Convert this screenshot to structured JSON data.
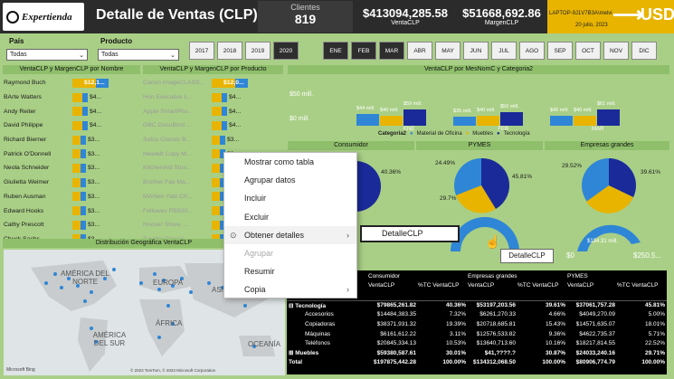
{
  "header": {
    "logo_text": "Expertienda",
    "title": "Detalle de Ventas (CLP)",
    "clients_label": "Clientes",
    "clients_value": "819",
    "venta_value": "$413094,285.58",
    "venta_label": "VentaCLP",
    "margen_value": "$51668,692.86",
    "margen_label": "MargenCLP",
    "user": "LAPTOP-9J1V7B3A\\melvi",
    "date": "20 julio, 2023",
    "currency": "USD"
  },
  "filters": {
    "pais_label": "País",
    "pais_value": "Todas",
    "producto_label": "Producto",
    "producto_value": "Todas"
  },
  "years": [
    "2017",
    "2018",
    "2019",
    "2020"
  ],
  "months": [
    "ENE",
    "FEB",
    "MAR",
    "ABR",
    "MAY",
    "JUN",
    "JUL",
    "AGO",
    "SEP",
    "OCT",
    "NOV",
    "DIC"
  ],
  "colors": {
    "gold": "#e8b400",
    "blue": "#2f86d6",
    "navy": "#1a2a99",
    "bg": "#a9cf86"
  },
  "sections": {
    "por_nombre": "VentaCLP y MargenCLP por Nombre",
    "por_producto": "VentaCLP y MargenCLP por Producto",
    "por_mes": "VentaCLP por MesNomC y Categoria2",
    "mapa": "Distribución Geográfica VentaCLP"
  },
  "nombres": [
    {
      "name": "Raymond Buch",
      "val": "$12,1..."
    },
    {
      "name": "BArte Watters",
      "val": "$4..."
    },
    {
      "name": "Andy Reiter",
      "val": "$4..."
    },
    {
      "name": "David Philippe",
      "val": "$4..."
    },
    {
      "name": "Richard Bierner",
      "val": "$3..."
    },
    {
      "name": "Patrick O'Donnell",
      "val": "$3..."
    },
    {
      "name": "Neola Schneider",
      "val": "$3..."
    },
    {
      "name": "Giulietta Weimer",
      "val": "$3..."
    },
    {
      "name": "Ruben Ausman",
      "val": "$3..."
    },
    {
      "name": "Edward Hooks",
      "val": "$3..."
    },
    {
      "name": "Cathy Prescott",
      "val": "$3..."
    },
    {
      "name": "Chuck Sachs",
      "val": "$3..."
    }
  ],
  "productos": [
    {
      "name": "Canon imageCLASS...",
      "val": "$12,0..."
    },
    {
      "name": "Hon Executive L...",
      "val": "$4..."
    },
    {
      "name": "Apple SmartPho...",
      "val": "$4..."
    },
    {
      "name": "GBC DocuBind ...",
      "val": "$4..."
    },
    {
      "name": "Safco Classic B...",
      "val": "$3..."
    },
    {
      "name": "Hewlett Copy M...",
      "val": "$3..."
    },
    {
      "name": "KitchenAid Stov...",
      "val": "$3..."
    },
    {
      "name": "Brother Fax Ma...",
      "val": "$3..."
    },
    {
      "name": "MArtein Yale Ch...",
      "val": "$3..."
    },
    {
      "name": "Fellowes PB500...",
      "val": "$3..."
    },
    {
      "name": "Hoover Stove, ...",
      "val": "$3..."
    },
    {
      "name": "Sauder Classic...",
      "val": "$3..."
    }
  ],
  "chart_mes": {
    "y_labels": [
      "$50 mill.",
      "$0 mill."
    ],
    "months": [
      "ENE",
      "FEB",
      "MAR"
    ],
    "labels": [
      [
        "$44 mill.",
        "$40 mill.",
        "$59 mill."
      ],
      [
        "$35 mill.",
        "$40 mill.",
        "$50 mill."
      ],
      [
        "$40 mill.",
        "$40 mill.",
        "$61 mill."
      ]
    ],
    "legend_title": "Categoria2",
    "legend": [
      "Material de Oficina",
      "Muebles",
      "Tecnología"
    ]
  },
  "segmentos": {
    "consumidor": "Consumidor",
    "pymes": "PYMES",
    "grandes": "Empresas grandes",
    "consumidor_pcts": [
      "40.36%"
    ],
    "pymes_pcts": [
      "24.49%",
      "29.7%",
      "45.81%"
    ],
    "grandes_pcts": [
      "29.52%",
      "39.61%"
    ],
    "gauge_min": "$0",
    "gauge_center": "$134.31 mill.",
    "gauge_max": "$250.5..."
  },
  "map": {
    "labels": [
      "AMÉRICA DEL NORTE",
      "EUROPA",
      "ASIA",
      "ÁFRICA",
      "AMÉRICA DEL SUR",
      "OCEANÍA"
    ],
    "bing": "Microsoft Bing",
    "copy": "© 2023 TomTom, © 2023 Microsoft Corporation"
  },
  "menu": {
    "items": [
      "Mostrar como tabla",
      "Agrupar datos",
      "Incluir",
      "Excluir",
      "Obtener detalles",
      "Agrupar",
      "Resumir",
      "Copia"
    ],
    "submenu": "DetalleCLP",
    "tooltip": "DetalleCLP"
  },
  "table": {
    "headers": [
      "Consumidor",
      "Empresas grandes",
      "PYMES"
    ],
    "sub": [
      "VentaCLP",
      "%TC VentaCLP",
      "VentaCLP",
      "%TC VentaCLP",
      "VentaCLP",
      "%TC VentaCLP"
    ],
    "rows": [
      {
        "label": "⊟ Tecnología",
        "bold": true,
        "vals": [
          "$79865,261.82",
          "40.36%",
          "$53197,203.56",
          "39.61%",
          "$37061,757.28",
          "45.81%"
        ]
      },
      {
        "label": "Accesorios",
        "bold": false,
        "vals": [
          "$14484,383.35",
          "7.32%",
          "$6261,270.33",
          "4.66%",
          "$4049,270.09",
          "5.00%"
        ]
      },
      {
        "label": "Copiadoras",
        "bold": false,
        "vals": [
          "$38371,931.32",
          "19.39%",
          "$20718,685.81",
          "15.43%",
          "$14571,635.07",
          "18.01%"
        ]
      },
      {
        "label": "Máquinas",
        "bold": false,
        "vals": [
          "$6161,612.22",
          "3.11%",
          "$12576,533.82",
          "9.36%",
          "$4622,735.37",
          "5.71%"
        ]
      },
      {
        "label": "Teléfonos",
        "bold": false,
        "vals": [
          "$20845,334.13",
          "10.53%",
          "$13640,713.60",
          "10.16%",
          "$18217,814.55",
          "22.52%"
        ]
      },
      {
        "label": "⊞ Muebles",
        "bold": true,
        "vals": [
          "$59380,587.61",
          "30.01%",
          "$41,????.?",
          "30.87%",
          "$24033,240.16",
          "29.71%"
        ]
      },
      {
        "label": "Total",
        "bold": true,
        "vals": [
          "$197875,442.28",
          "100.00%",
          "$134312,068.50",
          "100.00%",
          "$80906,774.79",
          "100.00%"
        ]
      }
    ]
  }
}
